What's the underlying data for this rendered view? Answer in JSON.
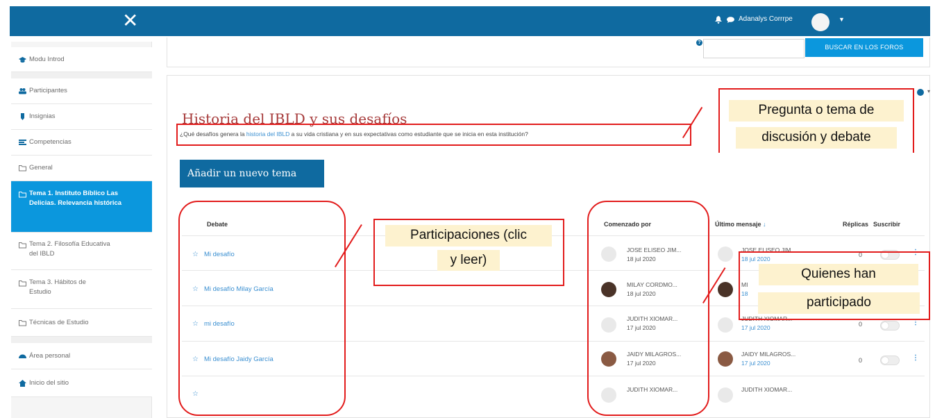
{
  "topbar": {
    "close_glyph": "✕",
    "username": "Adanalys Corrrpe",
    "icons": [
      "close-icon",
      "bell-icon",
      "chat-icon",
      "avatar",
      "chevron-down-icon"
    ]
  },
  "sidebar": {
    "items": [
      {
        "label": "Modu Introd",
        "icon": "graduation-cap-icon"
      },
      {
        "label": "Participantes",
        "icon": "users-icon"
      },
      {
        "label": "Insignias",
        "icon": "badge-icon"
      },
      {
        "label": "Competencias",
        "icon": "competencies-icon"
      },
      {
        "label": "General",
        "icon": "folder-icon"
      },
      {
        "label": "Tema 1. Instituto Bíblico Las Delicias. Relevancia histórica",
        "icon": "folder-icon",
        "active": true
      },
      {
        "label": "Tema 2. Filosofía Educativa del IBLD",
        "icon": "folder-icon"
      },
      {
        "label": "Tema 3. Hábitos de Estudio",
        "icon": "folder-icon"
      },
      {
        "label": "Técnicas de Estudio",
        "icon": "folder-icon"
      },
      {
        "label": "Área personal",
        "icon": "dashboard-icon"
      },
      {
        "label": "Inicio del sitio",
        "icon": "home-icon"
      }
    ]
  },
  "search": {
    "button_label": "BUSCAR EN LOS FOROS",
    "placeholder": "",
    "help_glyph": "?"
  },
  "forum": {
    "title": "Historia del IBLD y sus desafíos",
    "desc_prefix": "¿Qué desafíos genera la ",
    "desc_link": "historia del IBLD",
    "desc_suffix": " a su vida cristiana y en sus expectativas como estudiante que se inicia en esta institución?",
    "add_button": "Añadir un nuevo tema"
  },
  "table": {
    "headers": {
      "debate": "Debate",
      "started_by": "Comenzado por",
      "last_post": "Último mensaje",
      "sort_glyph": "↓",
      "replies": "Réplicas",
      "subscribe": "Suscribir"
    },
    "rows": [
      {
        "topic": "Mi desafío",
        "starter": "JOSE ELISEO JIM...",
        "start_date": "18 jul 2020",
        "last_name": "JOSE ELISEO JIM...",
        "last_date": "18 jul 2020",
        "replies": "0",
        "avatar": "grey"
      },
      {
        "topic": "Mi desafío Milay García",
        "starter": "MILAY CORDMO...",
        "start_date": "18 jul 2020",
        "last_name": "MI",
        "last_date": "18",
        "replies": "",
        "avatar": "dark"
      },
      {
        "topic": "mi desafío",
        "starter": "JUDITH XIOMAR...",
        "start_date": "17 jul 2020",
        "last_name": "JUDITH XIOMAR...",
        "last_date": "17 jul 2020",
        "replies": "0",
        "avatar": "grey"
      },
      {
        "topic": "Mi desafío Jaidy García",
        "starter": "JAIDY MILAGROS...",
        "start_date": "17 jul 2020",
        "last_name": "JAIDY MILAGROS...",
        "last_date": "17 jul 2020",
        "replies": "0",
        "avatar": "warm"
      },
      {
        "topic": "",
        "starter": "JUDITH XIOMAR...",
        "start_date": "",
        "last_name": "JUDITH XIOMAR...",
        "last_date": "",
        "replies": "",
        "avatar": "grey"
      }
    ]
  },
  "annotations": {
    "question": [
      "Pregunta o tema de",
      "discusión y debate"
    ],
    "participations": [
      "Participaciones (clic",
      "y leer)"
    ],
    "participants": [
      "Quienes han",
      "participado"
    ]
  },
  "colors": {
    "topbar": "#0f6aa0",
    "active": "#0b97dd",
    "title": "#a63a3a",
    "annotation": "#e21b1b",
    "callout_bg": "#fdf2cf"
  }
}
